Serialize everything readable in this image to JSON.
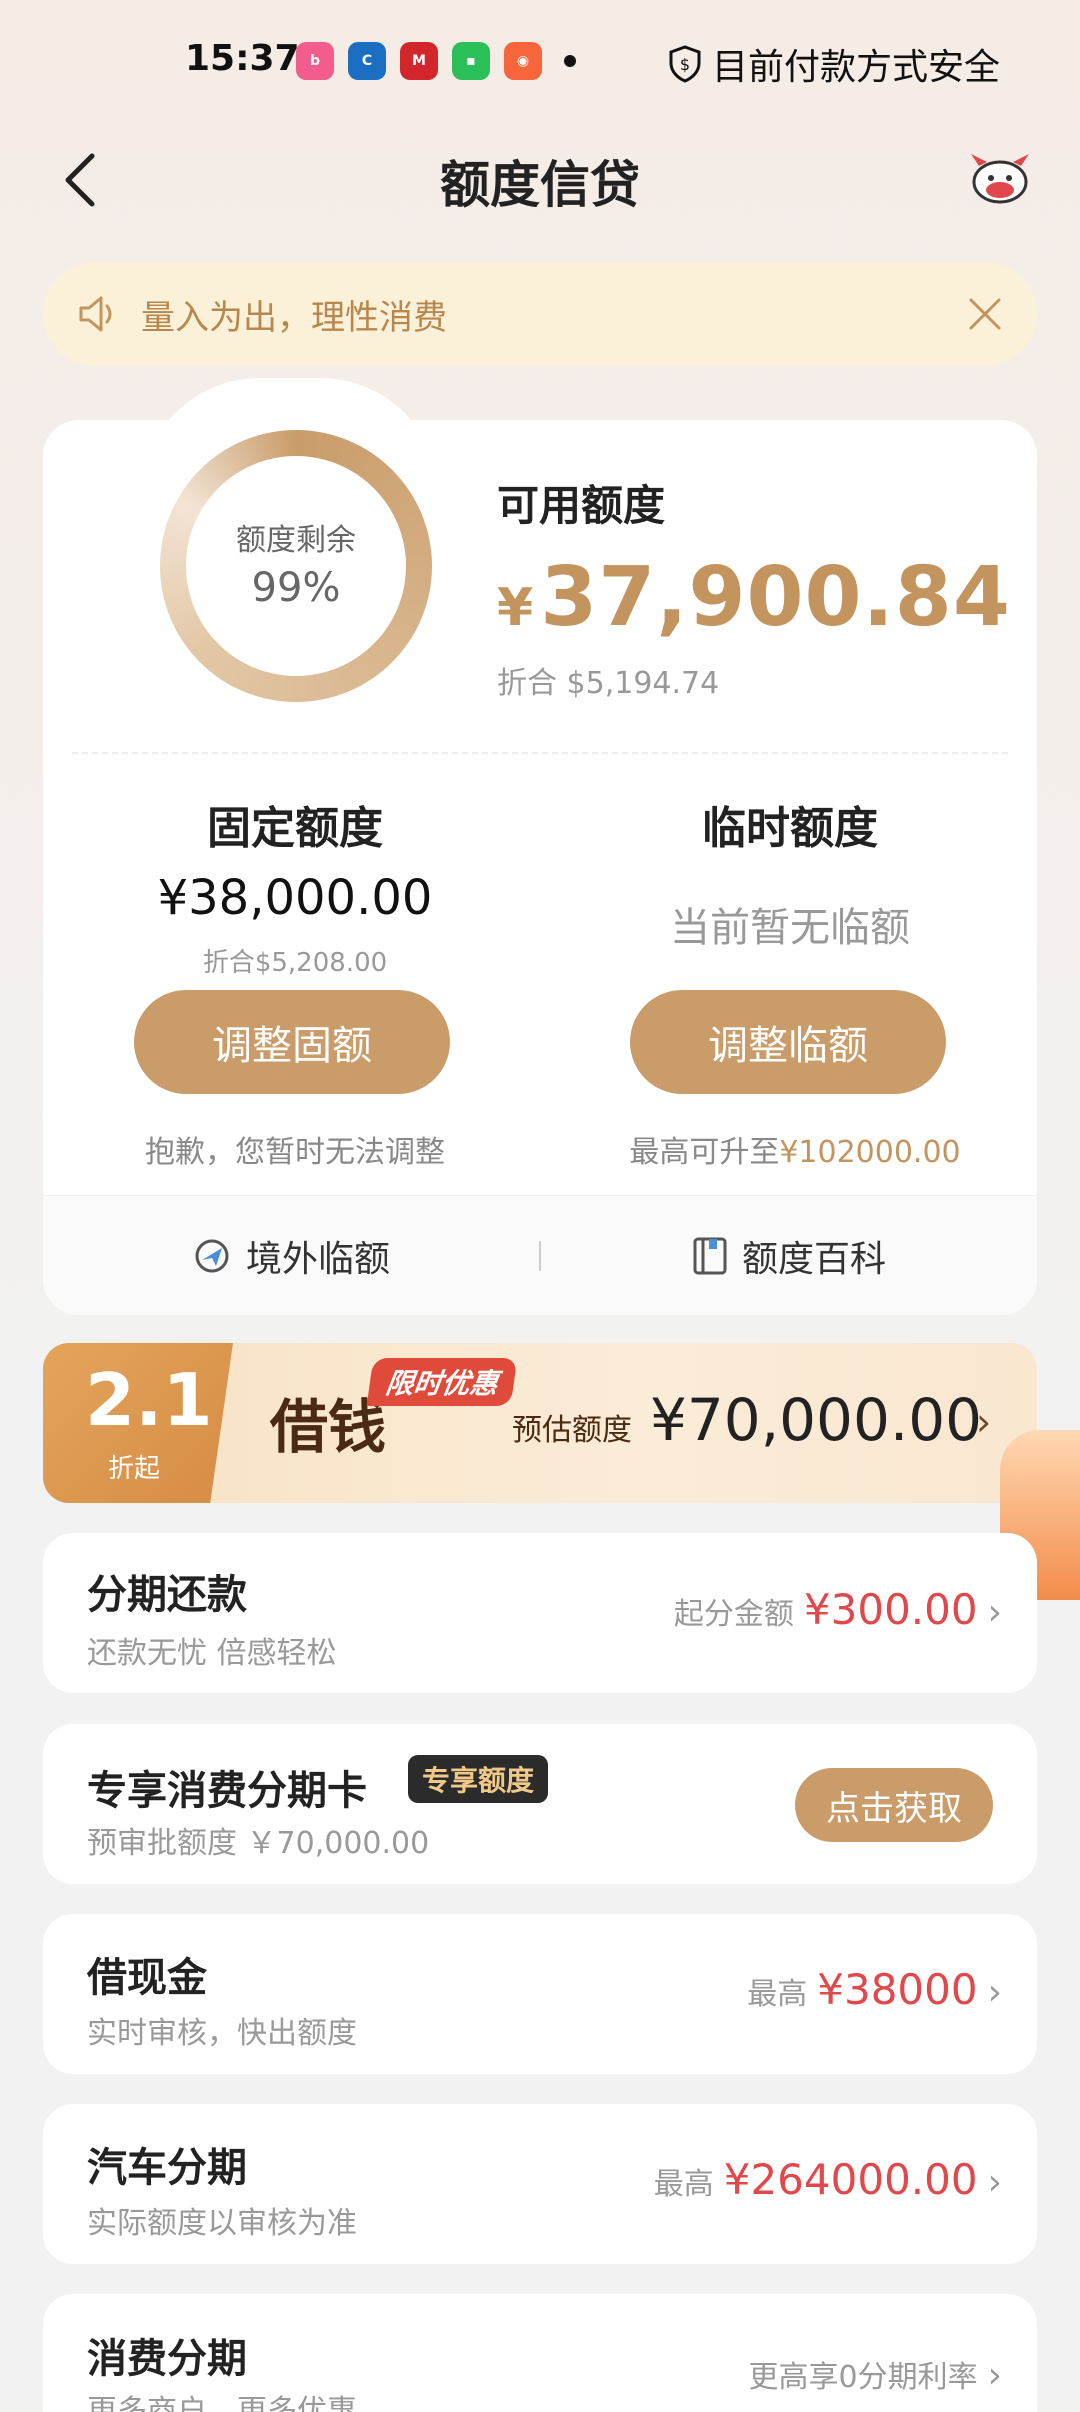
{
  "status_bar": {
    "time": "15:37",
    "security_text": "目前付款方式安全",
    "apps": [
      {
        "name": "bilibili",
        "color": "#f25d8e"
      },
      {
        "name": "ccb",
        "color": "#1b6ec2"
      },
      {
        "name": "cmb",
        "color": "#d2262c"
      },
      {
        "name": "chat",
        "color": "#2bbf5a"
      },
      {
        "name": "store",
        "color": "#f6653c"
      }
    ]
  },
  "header": {
    "title": "额度信贷"
  },
  "notice": {
    "text": "量入为出，理性消费"
  },
  "summary": {
    "ring_label": "额度剩余",
    "ring_percent": "99%",
    "ring_fraction": 0.99,
    "available_label": "可用额度",
    "currency_symbol": "¥",
    "available_amount": "37,900.84",
    "available_equiv": "折合  $5,194.74"
  },
  "fixed": {
    "title": "固定额度",
    "amount": "¥38,000.00",
    "equiv": "折合$5,208.00",
    "button": "调整固额",
    "note": "抱歉，您暂时无法调整"
  },
  "temporary": {
    "title": "临时额度",
    "status": "当前暂无临额",
    "button": "调整临额",
    "note_prefix": "最高可升至",
    "note_amount": "¥102000.00"
  },
  "footer_links": {
    "overseas": "境外临额",
    "wiki": "额度百科"
  },
  "promo": {
    "rate": "2.1",
    "rate_suffix": "折起",
    "tag": "限时优惠",
    "title": "借钱",
    "est_label": "预估额度",
    "est_amount": "¥70,000.00"
  },
  "products": [
    {
      "title": "分期还款",
      "sub": "还款无忧 倍感轻松",
      "right_label": "起分金额",
      "right_value": "¥300.00"
    },
    {
      "title": "专享消费分期卡",
      "badge": "专享额度",
      "sub": "预审批额度 ￥70,000.00",
      "button": "点击获取"
    },
    {
      "title": "借现金",
      "sub": "实时审核，快出额度",
      "right_label": "最高",
      "right_value": "¥38000"
    },
    {
      "title": "汽车分期",
      "sub": "实际额度以审核为准",
      "right_label": "最高",
      "right_value": "¥264000.00"
    },
    {
      "title": "消费分期",
      "sub": "更多商户，更多优惠",
      "right_label": "更高享0分期利率",
      "right_value": ""
    }
  ],
  "colors": {
    "accent_gold": "#c99c6a",
    "amount_red": "#e0484b",
    "notice_bg": "#fbf1d8"
  }
}
